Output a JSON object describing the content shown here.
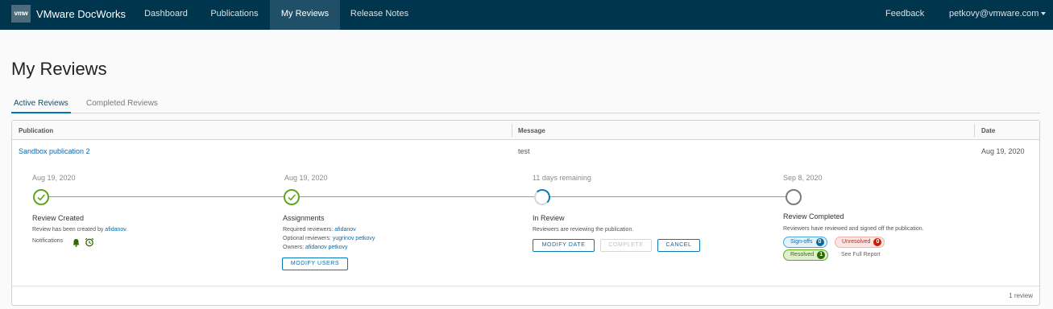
{
  "app": {
    "logo_text": "vmw",
    "name": "VMware DocWorks"
  },
  "nav": {
    "items": [
      "Dashboard",
      "Publications",
      "My Reviews",
      "Release Notes"
    ],
    "active": "My Reviews"
  },
  "header_right": {
    "feedback": "Feedback",
    "user": "petkovy@vmware.com"
  },
  "page": {
    "title": "My Reviews"
  },
  "tabs": {
    "active": "Active Reviews",
    "completed": "Completed Reviews"
  },
  "table": {
    "columns": {
      "publication": "Publication",
      "message": "Message",
      "date": "Date"
    },
    "row": {
      "publication": "Sandbox publication 2",
      "message": "test",
      "date": "Aug 19, 2020"
    },
    "footer": "1 review"
  },
  "steps": {
    "created": {
      "date": "Aug 19, 2020",
      "title": "Review Created",
      "text_prefix": "Review has been created by",
      "creator": "afidanov.",
      "notifications_label": "Notifications"
    },
    "assignments": {
      "date": "Aug 19, 2020",
      "title": "Assignments",
      "required_label": "Required reviewers:",
      "required": "afidanov",
      "optional_label": "Optional reviewers:",
      "optional_1": "yugrinov",
      "optional_2": "petkovy",
      "owners_label": "Owners:",
      "owner_1": "afidanov",
      "owner_2": "petkovy",
      "button": "MODIFY USERS"
    },
    "in_review": {
      "date": "11 days remaining",
      "title": "In Review",
      "text": "Reviewers are reviewing the publication.",
      "btn_modify": "MODIFY DATE",
      "btn_complete": "COMPLETE",
      "btn_cancel": "CANCEL"
    },
    "completed": {
      "date": "Sep 8, 2020",
      "title": "Review Completed",
      "text": "Reviewers have reviewed and signed off the publication.",
      "signoffs_label": "Sign-offs",
      "signoffs": "0",
      "unresolved_label": "Unresolved",
      "unresolved": "0",
      "resolved_label": "Resolved",
      "resolved": "1",
      "report_link": "See Full Report"
    }
  },
  "colors": {
    "header": "#00364d",
    "nav_active": "#1f5068",
    "accent": "#0079b8",
    "success": "#62a420"
  },
  "icons": [
    "bell-icon",
    "alarm-clock-icon",
    "chevron-down-icon"
  ]
}
